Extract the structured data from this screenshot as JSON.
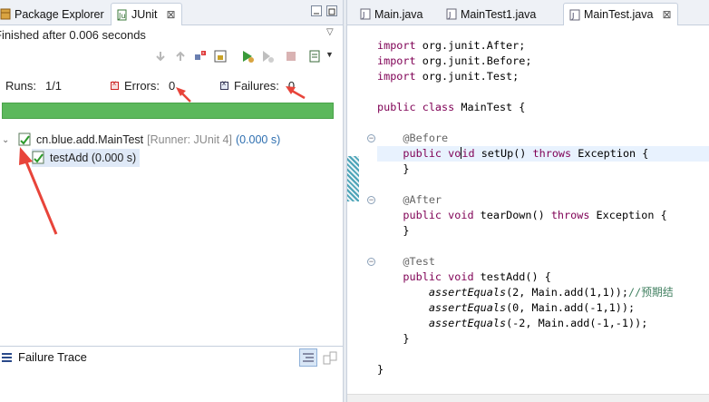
{
  "left_tabs": [
    {
      "label": "Package Explorer",
      "icon": "package-explorer-icon"
    },
    {
      "label": "JUnit",
      "icon": "junit-icon"
    }
  ],
  "junit": {
    "status": "Finished after 0.006 seconds",
    "runs_label": "Runs:",
    "runs_value": "1/1",
    "errors_label": "Errors:",
    "errors_value": "0",
    "failures_label": "Failures:",
    "failures_value": "0",
    "progress": 1.0,
    "progress_color": "#5cb85c",
    "tree": [
      {
        "name": "cn.blue.add.MainTest",
        "runner": "[Runner: JUnit 4]",
        "time": "(0.000 s)"
      },
      {
        "name": "testAdd (0.000 s)"
      }
    ],
    "failure_trace_label": "Failure Trace",
    "annotation_color": "#e8443a"
  },
  "editor_tabs": [
    {
      "label": "Main.java"
    },
    {
      "label": "MainTest1.java"
    },
    {
      "label": "MainTest.java"
    }
  ],
  "code_lines": [
    "import org.junit.After;",
    "import org.junit.Before;",
    "import org.junit.Test;",
    "",
    "public class MainTest {",
    "",
    "    @Before",
    "    public void setUp() throws Exception {",
    "    }",
    "",
    "    @After",
    "    public void tearDown() throws Exception {",
    "    }",
    "",
    "    @Test",
    "    public void testAdd() {",
    "        assertEquals(2, Main.add(1,1));//预期结",
    "        assertEquals(0, Main.add(-1,1));",
    "        assertEquals(-2, Main.add(-1,-1));",
    "    }",
    "",
    "}"
  ]
}
